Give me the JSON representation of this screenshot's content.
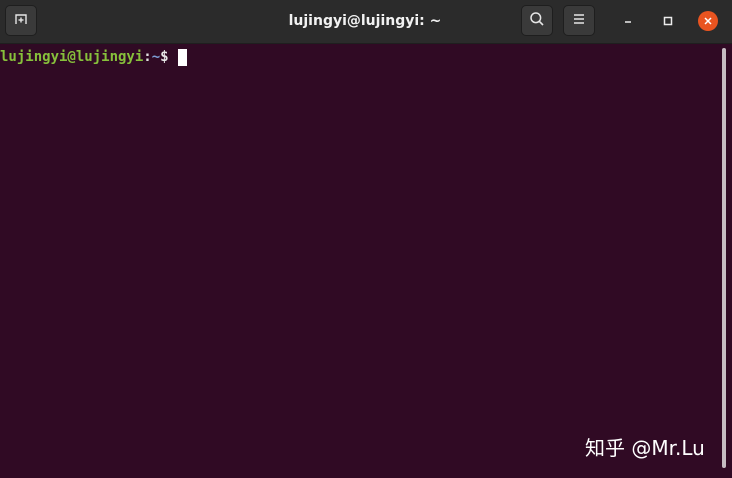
{
  "window": {
    "title": "lujingyi@lujingyi: ~",
    "icons": {
      "new_tab": "new-tab-icon",
      "search": "search-icon",
      "menu": "hamburger-menu-icon",
      "minimize": "minimize-icon",
      "maximize": "maximize-icon",
      "close": "close-icon"
    },
    "colors": {
      "header_bg": "#2b2b2b",
      "terminal_bg": "#300a24",
      "close_button": "#e95420"
    }
  },
  "terminal": {
    "prompt": {
      "user_host": "lujingyi@lujingyi",
      "separator": ":",
      "path": "~",
      "symbol": "$"
    },
    "colors": {
      "user_host": "#87c03b",
      "path": "#7d9fd6"
    }
  },
  "watermark": {
    "text": "知乎 @Mr.Lu"
  }
}
